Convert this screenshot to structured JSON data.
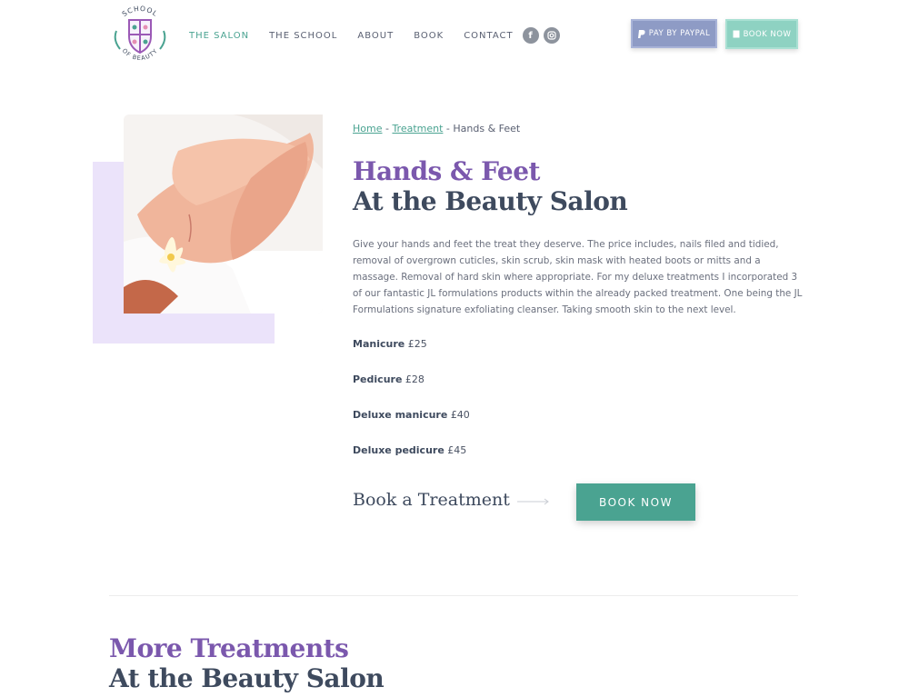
{
  "header": {
    "logo": {
      "text_top": "SCHOOL",
      "text_bottom": "OF BEAUTY"
    },
    "nav": [
      {
        "label": "THE SALON",
        "active": true
      },
      {
        "label": "THE SCHOOL"
      },
      {
        "label": "ABOUT"
      },
      {
        "label": "BOOK"
      },
      {
        "label": "CONTACT"
      }
    ],
    "social": {
      "facebook_glyph": "f",
      "instagram_icon": "instagram-icon"
    },
    "paypal_label": "PAY BY PAYPAL",
    "book_label": "BOOK NOW"
  },
  "breadcrumb": {
    "home": "Home",
    "sep": " - ",
    "treatment": "Treatment",
    "current": "Hands & Feet"
  },
  "title": {
    "line1": "Hands & Feet",
    "line2": "At the Beauty Salon"
  },
  "description": "Give your hands and feet the treat they deserve. The price includes, nails filed and tidied, removal of overgrown cuticles, skin scrub, skin mask with heated boots or mitts and a massage. Removal of hard skin where appropriate. For my deluxe treatments I incorporated 3 of our fantastic JL formulations products within the already packed  treatment. One being the JL Formulations signature exfoliating cleanser. Taking smooth skin to the next level.",
  "prices": [
    {
      "name": "Manicure",
      "price": "£25"
    },
    {
      "name": "Pedicure",
      "price": "£28"
    },
    {
      "name": "Deluxe manicure",
      "price": "£40"
    },
    {
      "name": "Deluxe pedicure",
      "price": "£45"
    }
  ],
  "cta": {
    "label": "Book a Treatment",
    "button": "BOOK NOW"
  },
  "more": {
    "line1": "More Treatments",
    "line2": "At the Beauty Salon"
  },
  "colors": {
    "accent_green": "#4aa391",
    "accent_purple": "#7b58ad",
    "lilac": "#ebe3fa",
    "paypal": "#8e9bc5"
  }
}
